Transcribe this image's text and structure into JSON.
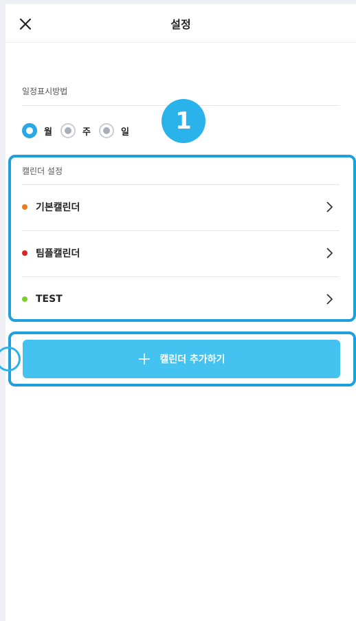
{
  "header": {
    "title": "설정",
    "close_icon": "close-icon"
  },
  "display_method": {
    "label": "일정표시방법",
    "options": [
      {
        "label": "월",
        "selected": true
      },
      {
        "label": "주",
        "selected": false
      },
      {
        "label": "일",
        "selected": false
      }
    ]
  },
  "badge": {
    "number": "1"
  },
  "calendar_settings": {
    "label": "캘린더 설정",
    "items": [
      {
        "name": "기본캘린더",
        "color": "#f07b1c"
      },
      {
        "name": "팀플캘린더",
        "color": "#e02424"
      },
      {
        "name": "TEST",
        "color": "#7ccf2a"
      }
    ]
  },
  "add_button": {
    "label": "캘린더 추가하기"
  },
  "colors": {
    "accent": "#45c3f0",
    "highlight": "#1f9fdb"
  }
}
